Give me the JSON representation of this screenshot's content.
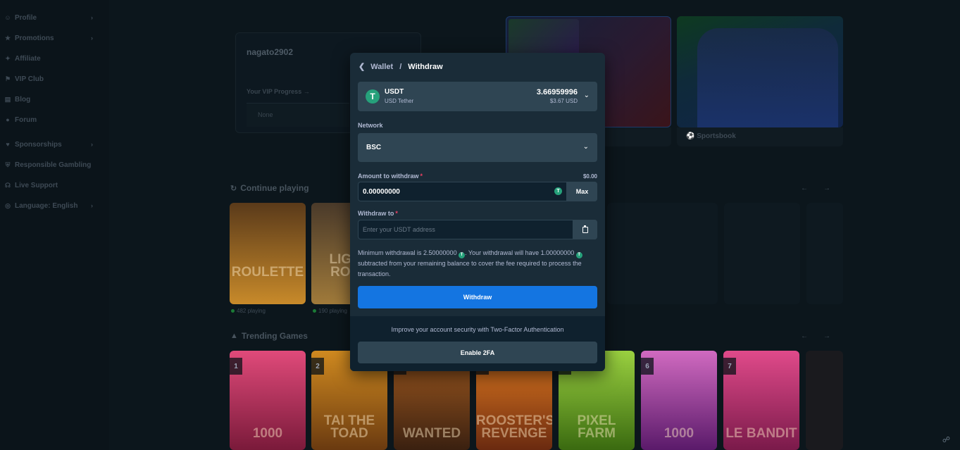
{
  "sidebar": {
    "items": [
      {
        "label": "Profile",
        "icon": "profile-icon",
        "chevron": true
      },
      {
        "label": "Promotions",
        "icon": "promotions-icon",
        "chevron": true
      },
      {
        "label": "Affiliate",
        "icon": "affiliate-icon",
        "chevron": false
      },
      {
        "label": "VIP Club",
        "icon": "trophy-icon",
        "chevron": false
      },
      {
        "label": "Blog",
        "icon": "blog-icon",
        "chevron": false
      },
      {
        "label": "Forum",
        "icon": "forum-icon",
        "chevron": false
      },
      {
        "label": "Sponsorships",
        "icon": "sponsorships-icon",
        "chevron": true
      },
      {
        "label": "Responsible Gambling",
        "icon": "shield-icon",
        "chevron": false
      },
      {
        "label": "Live Support",
        "icon": "headset-icon",
        "chevron": false
      },
      {
        "label": "Language: English",
        "icon": "globe-icon",
        "chevron": true
      }
    ]
  },
  "user": {
    "name": "nagato2902",
    "vip_label": "Your VIP Progress",
    "vip_value": "None"
  },
  "promos": {
    "sportsbook_label": "Sportsbook"
  },
  "sections": {
    "continue": "Continue playing",
    "trending": "Trending Games"
  },
  "continue_games": [
    {
      "title": "ROULETTE",
      "playing": "482 playing",
      "color1": "#5a3a1a",
      "color2": "#c88a2a"
    },
    {
      "title": "LIGHT ROUL",
      "playing": "190 playing",
      "color1": "#4a3a2a",
      "color2": "#a07a3a"
    }
  ],
  "trending_games": [
    {
      "rank": "1",
      "title": "1000",
      "color1": "#7a1a3a",
      "color2": "#e04a7a"
    },
    {
      "rank": "2",
      "title": "TAI THE TOAD",
      "color1": "#6a3a10",
      "color2": "#d08a20"
    },
    {
      "rank": "3",
      "title": "WANTED",
      "color1": "#3a2010",
      "color2": "#a05a20"
    },
    {
      "rank": "4",
      "title": "ROOSTER'S REVENGE",
      "color1": "#6a2a10",
      "color2": "#e07a20"
    },
    {
      "rank": "5",
      "title": "PIXEL FARM",
      "color1": "#3a6a10",
      "color2": "#9ad040"
    },
    {
      "rank": "6",
      "title": "1000",
      "color1": "#5a1a6a",
      "color2": "#d06ac0"
    },
    {
      "rank": "7",
      "title": "LE BANDIT",
      "color1": "#7a1a4a",
      "color2": "#e04a8a"
    }
  ],
  "modal": {
    "crumb_parent": "Wallet",
    "crumb_sep": "/",
    "crumb_current": "Withdraw",
    "coin": {
      "code": "USDT",
      "name": "USD Tether",
      "balance": "3.66959996",
      "balance_usd": "$3.67 USD",
      "glyph": "T"
    },
    "network_label": "Network",
    "network_value": "BSC",
    "amount_label": "Amount to withdraw",
    "amount_usd": "$0.00",
    "amount_value": "0.00000000",
    "max_label": "Max",
    "withdraw_to_label": "Withdraw to",
    "address_placeholder": "Enter your USDT address",
    "required_mark": "*",
    "info": {
      "p1": "Minimum withdrawal is 2.50000000",
      "p2": ". Your withdrawal will have",
      "p3": "1.00000000",
      "p4": "subtracted from your remaining balance to cover the fee required to process the transaction."
    },
    "withdraw_button": "Withdraw",
    "twofa_text": "Improve your account security with Two-Factor Authentication",
    "enable_button": "Enable 2FA"
  },
  "colors": {
    "accent": "#1475e1",
    "tether": "#26a17b",
    "modal_bg": "#1a2c38",
    "input_bg": "#0f212e"
  }
}
